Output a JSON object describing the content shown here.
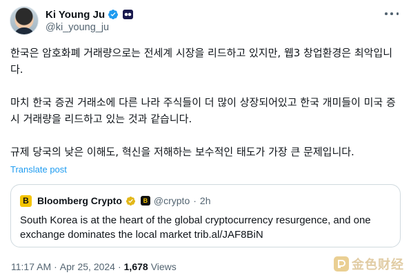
{
  "author": {
    "name": "Ki Young Ju",
    "handle": "@ki_young_ju"
  },
  "body": {
    "paragraph1": "한국은 암호화폐 거래량으로는 전세계 시장을 리드하고 있지만, 웹3 창업환경은 최악입니다.",
    "paragraph2": "마치 한국 증권 거래소에 다른 나라 주식들이 더 많이 상장되어있고 한국 개미들이 미국 증시 거래량을 리드하고 있는 것과 같습니다.",
    "paragraph3": "규제 당국의 낮은 이해도, 혁신을 저해하는 보수적인 태도가 가장 큰 문제입니다."
  },
  "translate_label": "Translate post",
  "quote": {
    "logo_letter": "B",
    "name": "Bloomberg Crypto",
    "aff_letter": "B",
    "handle": "@crypto",
    "dot": "·",
    "time": "2h",
    "text": "South Korea is at the heart of the global cryptocurrency resurgence, and one exchange dominates the local market trib.al/JAF8BiN"
  },
  "meta": {
    "time": "11:17 AM",
    "sep1": "·",
    "date": "Apr 25, 2024",
    "sep2": "·",
    "views_count": "1,678",
    "views_label": "Views"
  },
  "watermark": {
    "text": "金色财经"
  },
  "colors": {
    "link_blue": "#1d9bf0",
    "verified_blue": "#1d9bf0",
    "gold_check": "#e2b719",
    "secondary_text": "#536471"
  }
}
